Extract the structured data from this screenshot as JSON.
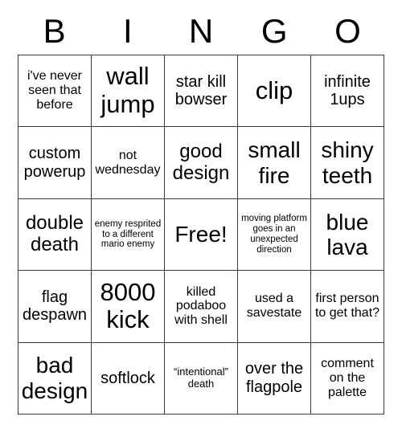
{
  "card": {
    "title_letters": [
      "B",
      "I",
      "N",
      "G",
      "O"
    ],
    "background_color": "#ffffff",
    "text_color": "#000000",
    "border_color": "#3a3a3a",
    "grid_size": "5x5"
  },
  "cells": [
    {
      "text": "i've never seen that before",
      "size": "sm",
      "free": false
    },
    {
      "text": "wall jump",
      "size": "xxl",
      "free": false
    },
    {
      "text": "star kill bowser",
      "size": "md",
      "free": false
    },
    {
      "text": "clip",
      "size": "xxl",
      "free": false
    },
    {
      "text": "infinite 1ups",
      "size": "md",
      "free": false
    },
    {
      "text": "custom powerup",
      "size": "md",
      "free": false
    },
    {
      "text": "not wednesday",
      "size": "sm",
      "free": false
    },
    {
      "text": "good design",
      "size": "lg",
      "free": false
    },
    {
      "text": "small fire",
      "size": "xl",
      "free": false
    },
    {
      "text": "shiny teeth",
      "size": "xl",
      "free": false
    },
    {
      "text": "double death",
      "size": "lg",
      "free": false
    },
    {
      "text": "enemy resprited to a different mario enemy",
      "size": "xxs",
      "free": false
    },
    {
      "text": "Free!",
      "size": "xl",
      "free": true
    },
    {
      "text": "moving platform goes in an unexpected direction",
      "size": "xxs",
      "free": false
    },
    {
      "text": "blue lava",
      "size": "xl",
      "free": false
    },
    {
      "text": "flag despawn",
      "size": "md",
      "free": false
    },
    {
      "text": "8000 kick",
      "size": "xxl",
      "free": false
    },
    {
      "text": "killed podaboo with shell",
      "size": "sm",
      "free": false
    },
    {
      "text": "used a savestate",
      "size": "sm",
      "free": false
    },
    {
      "text": "first person to get that?",
      "size": "sm",
      "free": false
    },
    {
      "text": "bad design",
      "size": "xl",
      "free": false
    },
    {
      "text": "softlock",
      "size": "md",
      "free": false
    },
    {
      "text": "“intentional” death",
      "size": "xs",
      "free": false
    },
    {
      "text": "over the flagpole",
      "size": "md",
      "free": false
    },
    {
      "text": "comment on the palette",
      "size": "sm",
      "free": false
    }
  ]
}
